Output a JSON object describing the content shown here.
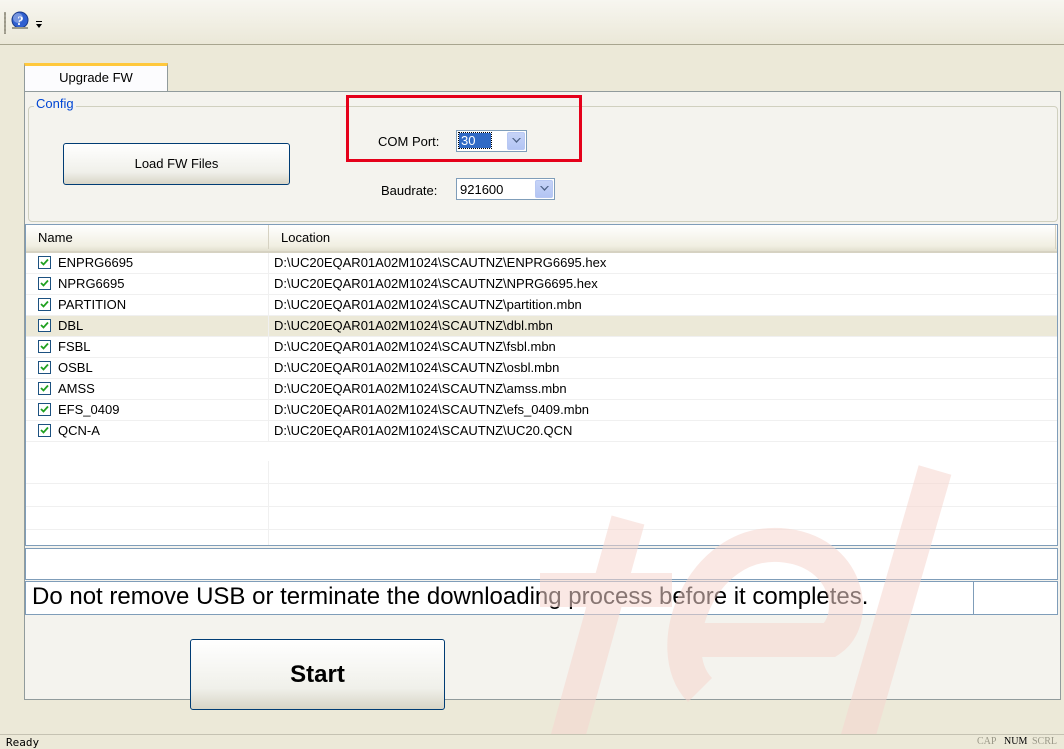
{
  "toolbar": {
    "help_icon": "help-icon",
    "dropdown_icon": "chevron-down-icon"
  },
  "tabs": [
    {
      "label": "Upgrade FW",
      "active": true
    }
  ],
  "config": {
    "group_label": "Config",
    "load_button": "Load FW Files",
    "com_port": {
      "label": "COM Port:",
      "value": "30"
    },
    "baudrate": {
      "label": "Baudrate:",
      "value": "921600"
    }
  },
  "table": {
    "columns": [
      "Name",
      "Location"
    ],
    "rows": [
      {
        "checked": true,
        "name": "ENPRG6695",
        "location": "D:\\UC20EQAR01A02M1024\\SCAUTNZ\\ENPRG6695.hex"
      },
      {
        "checked": true,
        "name": "NPRG6695",
        "location": "D:\\UC20EQAR01A02M1024\\SCAUTNZ\\NPRG6695.hex"
      },
      {
        "checked": true,
        "name": "PARTITION",
        "location": "D:\\UC20EQAR01A02M1024\\SCAUTNZ\\partition.mbn"
      },
      {
        "checked": true,
        "name": "DBL",
        "location": "D:\\UC20EQAR01A02M1024\\SCAUTNZ\\dbl.mbn"
      },
      {
        "checked": true,
        "name": "FSBL",
        "location": "D:\\UC20EQAR01A02M1024\\SCAUTNZ\\fsbl.mbn"
      },
      {
        "checked": true,
        "name": "OSBL",
        "location": "D:\\UC20EQAR01A02M1024\\SCAUTNZ\\osbl.mbn"
      },
      {
        "checked": true,
        "name": "AMSS",
        "location": "D:\\UC20EQAR01A02M1024\\SCAUTNZ\\amss.mbn"
      },
      {
        "checked": true,
        "name": "EFS_0409",
        "location": "D:\\UC20EQAR01A02M1024\\SCAUTNZ\\efs_0409.mbn"
      },
      {
        "checked": true,
        "name": "QCN-A",
        "location": "D:\\UC20EQAR01A02M1024\\SCAUTNZ\\UC20.QCN"
      }
    ]
  },
  "warning": "Do not remove USB or terminate the downloading process before it completes.",
  "start_button": "Start",
  "status_bar": {
    "text": "Ready",
    "caps": "CAP",
    "num": "NUM",
    "scrl": "SCRL"
  },
  "colors": {
    "highlight": "#e5001a",
    "tab_accent": "#ffc83c",
    "group_label": "#0046d5"
  }
}
